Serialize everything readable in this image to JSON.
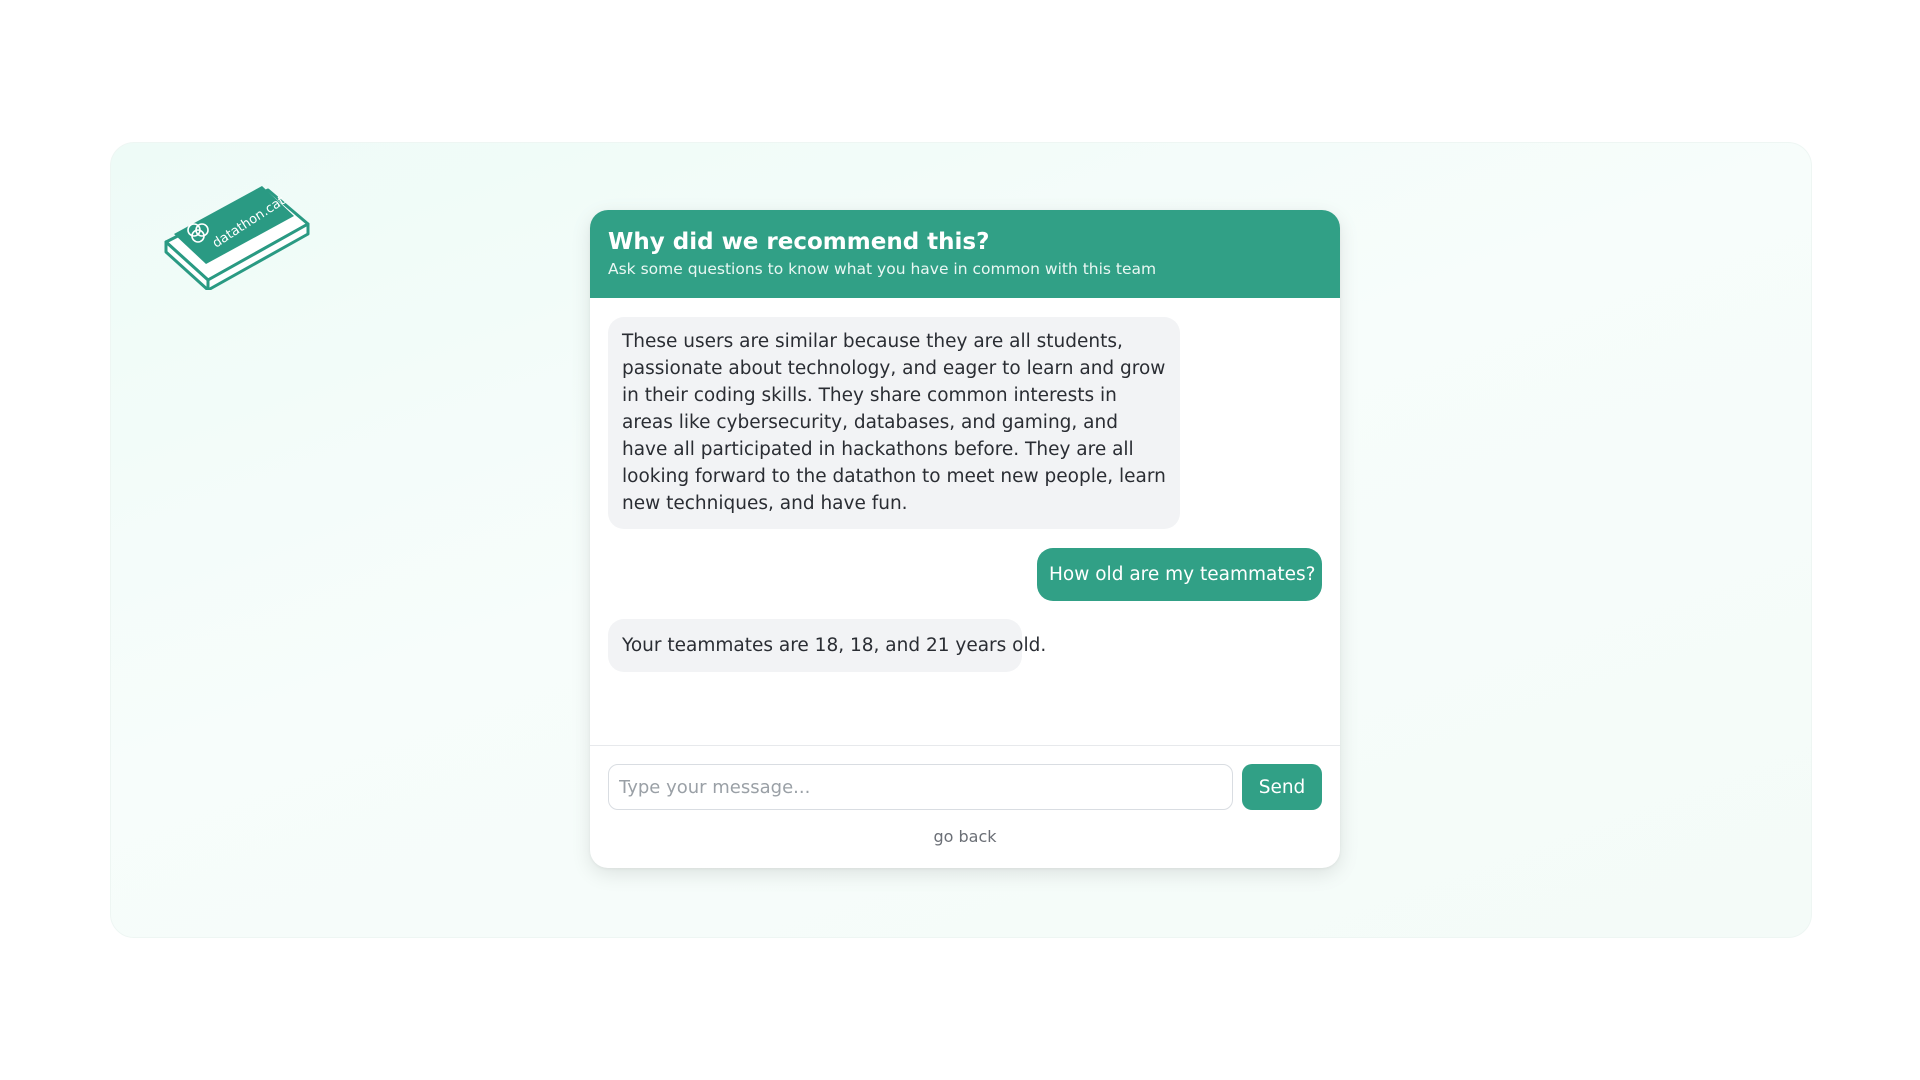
{
  "logo": {
    "text": "datathon.cat",
    "color": "#2a9a83",
    "icon": "datathon-logo-icon"
  },
  "chat": {
    "title": "Why did we recommend this?",
    "subtitle": "Ask some questions to know what you have in common with this team",
    "messages": [
      {
        "role": "bot",
        "text": "These users are similar because they are all students, passionate about technology, and eager to learn and grow in their coding skills. They share common interests in areas like cybersecurity, databases, and gaming, and have all participated in hackathons before. They are all looking forward to the datathon to meet new people, learn new techniques, and have fun."
      },
      {
        "role": "user",
        "text": "How old are my teammates?"
      },
      {
        "role": "bot",
        "text": "Your teammates are 18, 18, and 21 years old."
      }
    ],
    "input_placeholder": "Type your message...",
    "input_value": "",
    "send_label": "Send",
    "back_label": "go back"
  },
  "colors": {
    "accent": "#31a086",
    "bot_bubble": "#f2f3f5",
    "background_panel": "#eefbf7"
  }
}
